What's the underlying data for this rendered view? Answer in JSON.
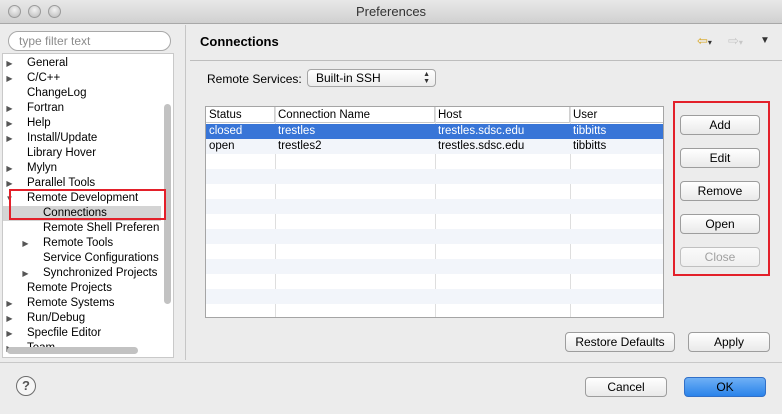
{
  "window": {
    "title": "Preferences"
  },
  "filter": {
    "placeholder": "type filter text"
  },
  "tree": [
    {
      "label": "General",
      "level": 0,
      "twisty": "collapsed"
    },
    {
      "label": "C/C++",
      "level": 0,
      "twisty": "collapsed"
    },
    {
      "label": "ChangeLog",
      "level": 0,
      "twisty": "none"
    },
    {
      "label": "Fortran",
      "level": 0,
      "twisty": "collapsed"
    },
    {
      "label": "Help",
      "level": 0,
      "twisty": "collapsed"
    },
    {
      "label": "Install/Update",
      "level": 0,
      "twisty": "collapsed"
    },
    {
      "label": "Library Hover",
      "level": 0,
      "twisty": "none"
    },
    {
      "label": "Mylyn",
      "level": 0,
      "twisty": "collapsed"
    },
    {
      "label": "Parallel Tools",
      "level": 0,
      "twisty": "collapsed"
    },
    {
      "label": "Remote Development",
      "level": 0,
      "twisty": "expanded"
    },
    {
      "label": "Connections",
      "level": 1,
      "twisty": "none",
      "selected": true
    },
    {
      "label": "Remote Shell Preferen",
      "level": 1,
      "twisty": "none"
    },
    {
      "label": "Remote Tools",
      "level": 1,
      "twisty": "collapsed"
    },
    {
      "label": "Service Configurations",
      "level": 1,
      "twisty": "none"
    },
    {
      "label": "Synchronized Projects",
      "level": 1,
      "twisty": "collapsed"
    },
    {
      "label": "Remote Projects",
      "level": 0,
      "twisty": "none"
    },
    {
      "label": "Remote Systems",
      "level": 0,
      "twisty": "collapsed"
    },
    {
      "label": "Run/Debug",
      "level": 0,
      "twisty": "collapsed"
    },
    {
      "label": "Specfile Editor",
      "level": 0,
      "twisty": "collapsed"
    },
    {
      "label": "Team",
      "level": 0,
      "twisty": "collapsed"
    }
  ],
  "page": {
    "title": "Connections",
    "nav": {
      "back_icon": "back-arrow-icon",
      "forward_icon": "forward-arrow-icon",
      "menu_icon": "view-menu-icon"
    },
    "remote_services_label": "Remote Services:",
    "remote_services_value": "Built-in SSH"
  },
  "table": {
    "columns": [
      "Status",
      "Connection Name",
      "Host",
      "User"
    ],
    "rows": [
      {
        "status": "closed",
        "name": "trestles",
        "host": "trestles.sdsc.edu",
        "user": "tibbitts",
        "selected": true
      },
      {
        "status": "open",
        "name": "trestles2",
        "host": "trestles.sdsc.edu",
        "user": "tibbitts",
        "selected": false
      }
    ]
  },
  "buttons": {
    "add": "Add",
    "edit": "Edit",
    "remove": "Remove",
    "open": "Open",
    "close": "Close",
    "restore_defaults": "Restore Defaults",
    "apply": "Apply",
    "cancel": "Cancel",
    "ok": "OK"
  },
  "help": {
    "glyph": "?",
    "icon": "help-icon"
  },
  "colors": {
    "selection": "#3875d7",
    "annotation": "#e3202a",
    "primary_button": "#2a83ea"
  }
}
